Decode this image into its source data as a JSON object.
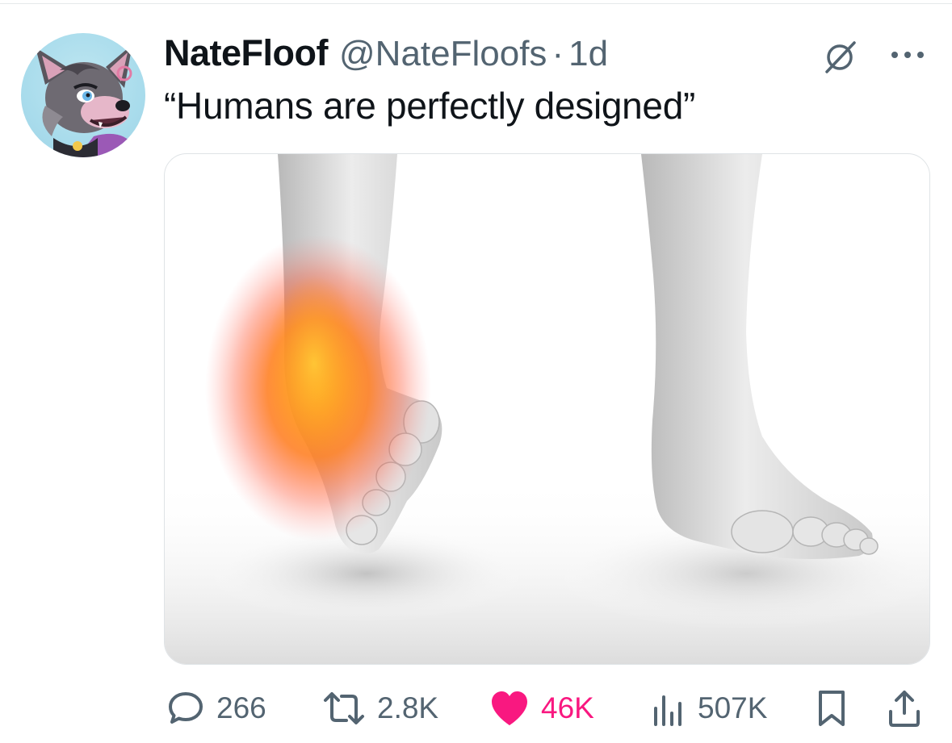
{
  "author": {
    "display_name": "NateFloof",
    "handle": "@NateFloofs",
    "separator": "·",
    "time": "1d",
    "avatar_icon": "fursona-avatar"
  },
  "tweet": {
    "text": "“Humans are perfectly designed”",
    "media_description_icon": "sprained-ankle-illustration"
  },
  "header_icons": {
    "grok": "grok-icon",
    "more": "more-options-icon"
  },
  "actions": {
    "replies": "266",
    "reposts": "2.8K",
    "likes": "46K",
    "views": "507K",
    "bookmark_icon": "bookmark-icon",
    "share_icon": "share-icon"
  },
  "colors": {
    "text_primary": "#0f1419",
    "text_secondary": "#536471",
    "like_pink": "#f91880",
    "border": "#dfe3e6"
  }
}
